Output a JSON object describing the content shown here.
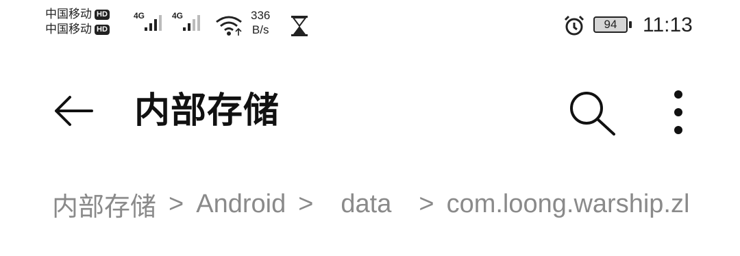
{
  "status_bar": {
    "carrier_1": "中国移动",
    "carrier_2": "中国移动",
    "hd_badge": "HD",
    "network_1": "4G",
    "network_2": "4G",
    "speed_value": "336",
    "speed_unit": "B/s",
    "battery": "94",
    "time": "11:13"
  },
  "app_bar": {
    "title": "内部存储",
    "icons": [
      "back-arrow-icon",
      "search-icon",
      "more-vert-icon"
    ]
  },
  "breadcrumb": {
    "items": [
      "内部存储",
      "Android",
      "data",
      "com.loong.warship.zl"
    ],
    "separator": ">"
  }
}
